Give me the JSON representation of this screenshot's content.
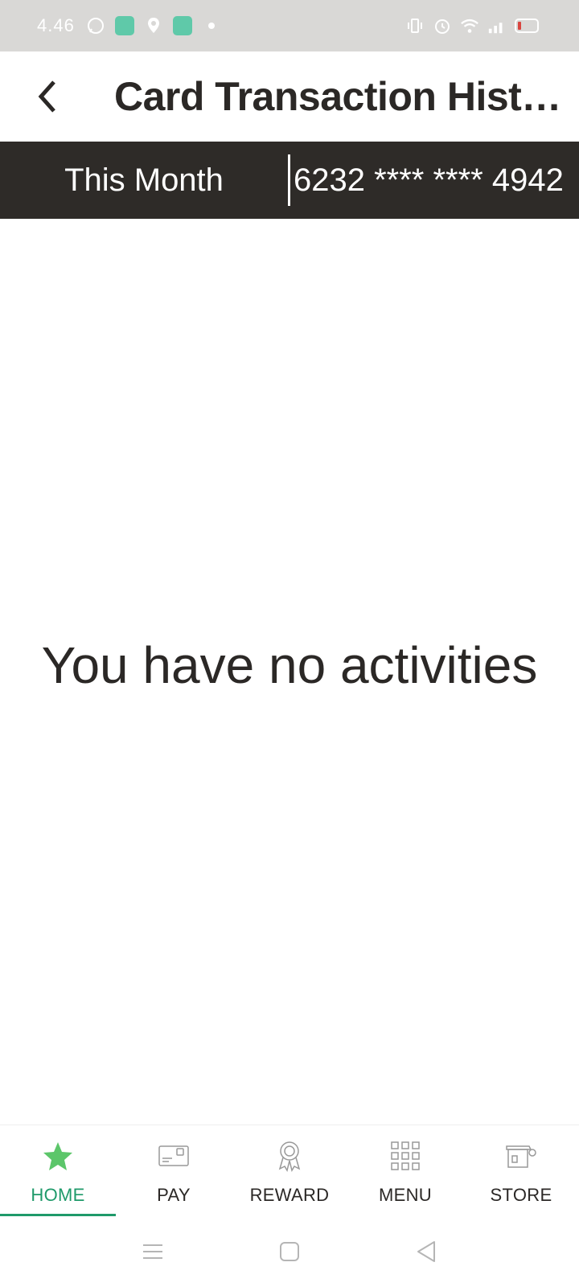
{
  "status_bar": {
    "time": "4.46",
    "left_icons": [
      "whatsapp-icon",
      "app-icon",
      "location-icon",
      "app-icon",
      "notification-dot-icon"
    ],
    "right_icons": [
      "vibrate-icon",
      "alarm-icon",
      "wifi-icon",
      "signal-icon",
      "battery-low-icon"
    ]
  },
  "header": {
    "title": "Card Transaction History"
  },
  "filter": {
    "period_label": "This Month",
    "card_label": "6232 **** **** 4942"
  },
  "main": {
    "empty_message": "You have no activities"
  },
  "bottom_nav": {
    "items": [
      {
        "label": "HOME",
        "icon": "star-icon",
        "active": true
      },
      {
        "label": "PAY",
        "icon": "card-icon",
        "active": false
      },
      {
        "label": "REWARD",
        "icon": "award-icon",
        "active": false
      },
      {
        "label": "MENU",
        "icon": "grid-icon",
        "active": false
      },
      {
        "label": "STORE",
        "icon": "store-icon",
        "active": false
      }
    ]
  },
  "colors": {
    "accent": "#1f9a6a",
    "star": "#5cc66a",
    "strip_bg": "#2e2b28",
    "status_bg": "#d9d8d6"
  }
}
